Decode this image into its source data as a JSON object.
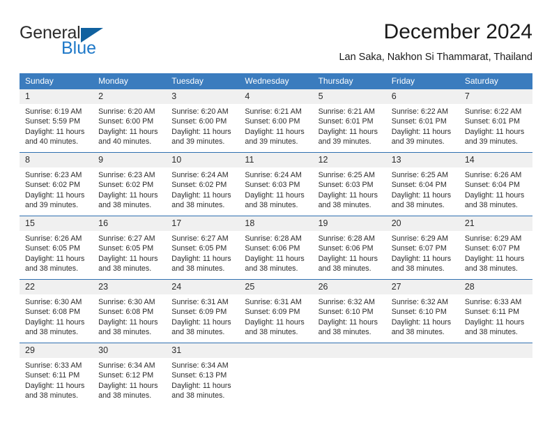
{
  "brand": {
    "name_part1": "General",
    "name_part2": "Blue",
    "logo_icon": "triangle-icon",
    "accent_color": "#1e78c8",
    "triangle_color": "#10619f"
  },
  "header": {
    "title": "December 2024",
    "subtitle": "Lan Saka, Nakhon Si Thammarat, Thailand"
  },
  "theme": {
    "header_row_bg": "#3b7cbe",
    "header_row_text": "#ffffff",
    "daynum_bg": "#f0f0f0",
    "row_divider": "#2f6fb0",
    "body_text": "#2b2b2b"
  },
  "calendar": {
    "weekday_headers": [
      "Sunday",
      "Monday",
      "Tuesday",
      "Wednesday",
      "Thursday",
      "Friday",
      "Saturday"
    ],
    "weeks": [
      [
        {
          "day": "1",
          "sunrise": "Sunrise: 6:19 AM",
          "sunset": "Sunset: 5:59 PM",
          "daylight_line1": "Daylight: 11 hours",
          "daylight_line2": "and 40 minutes."
        },
        {
          "day": "2",
          "sunrise": "Sunrise: 6:20 AM",
          "sunset": "Sunset: 6:00 PM",
          "daylight_line1": "Daylight: 11 hours",
          "daylight_line2": "and 40 minutes."
        },
        {
          "day": "3",
          "sunrise": "Sunrise: 6:20 AM",
          "sunset": "Sunset: 6:00 PM",
          "daylight_line1": "Daylight: 11 hours",
          "daylight_line2": "and 39 minutes."
        },
        {
          "day": "4",
          "sunrise": "Sunrise: 6:21 AM",
          "sunset": "Sunset: 6:00 PM",
          "daylight_line1": "Daylight: 11 hours",
          "daylight_line2": "and 39 minutes."
        },
        {
          "day": "5",
          "sunrise": "Sunrise: 6:21 AM",
          "sunset": "Sunset: 6:01 PM",
          "daylight_line1": "Daylight: 11 hours",
          "daylight_line2": "and 39 minutes."
        },
        {
          "day": "6",
          "sunrise": "Sunrise: 6:22 AM",
          "sunset": "Sunset: 6:01 PM",
          "daylight_line1": "Daylight: 11 hours",
          "daylight_line2": "and 39 minutes."
        },
        {
          "day": "7",
          "sunrise": "Sunrise: 6:22 AM",
          "sunset": "Sunset: 6:01 PM",
          "daylight_line1": "Daylight: 11 hours",
          "daylight_line2": "and 39 minutes."
        }
      ],
      [
        {
          "day": "8",
          "sunrise": "Sunrise: 6:23 AM",
          "sunset": "Sunset: 6:02 PM",
          "daylight_line1": "Daylight: 11 hours",
          "daylight_line2": "and 39 minutes."
        },
        {
          "day": "9",
          "sunrise": "Sunrise: 6:23 AM",
          "sunset": "Sunset: 6:02 PM",
          "daylight_line1": "Daylight: 11 hours",
          "daylight_line2": "and 38 minutes."
        },
        {
          "day": "10",
          "sunrise": "Sunrise: 6:24 AM",
          "sunset": "Sunset: 6:02 PM",
          "daylight_line1": "Daylight: 11 hours",
          "daylight_line2": "and 38 minutes."
        },
        {
          "day": "11",
          "sunrise": "Sunrise: 6:24 AM",
          "sunset": "Sunset: 6:03 PM",
          "daylight_line1": "Daylight: 11 hours",
          "daylight_line2": "and 38 minutes."
        },
        {
          "day": "12",
          "sunrise": "Sunrise: 6:25 AM",
          "sunset": "Sunset: 6:03 PM",
          "daylight_line1": "Daylight: 11 hours",
          "daylight_line2": "and 38 minutes."
        },
        {
          "day": "13",
          "sunrise": "Sunrise: 6:25 AM",
          "sunset": "Sunset: 6:04 PM",
          "daylight_line1": "Daylight: 11 hours",
          "daylight_line2": "and 38 minutes."
        },
        {
          "day": "14",
          "sunrise": "Sunrise: 6:26 AM",
          "sunset": "Sunset: 6:04 PM",
          "daylight_line1": "Daylight: 11 hours",
          "daylight_line2": "and 38 minutes."
        }
      ],
      [
        {
          "day": "15",
          "sunrise": "Sunrise: 6:26 AM",
          "sunset": "Sunset: 6:05 PM",
          "daylight_line1": "Daylight: 11 hours",
          "daylight_line2": "and 38 minutes."
        },
        {
          "day": "16",
          "sunrise": "Sunrise: 6:27 AM",
          "sunset": "Sunset: 6:05 PM",
          "daylight_line1": "Daylight: 11 hours",
          "daylight_line2": "and 38 minutes."
        },
        {
          "day": "17",
          "sunrise": "Sunrise: 6:27 AM",
          "sunset": "Sunset: 6:05 PM",
          "daylight_line1": "Daylight: 11 hours",
          "daylight_line2": "and 38 minutes."
        },
        {
          "day": "18",
          "sunrise": "Sunrise: 6:28 AM",
          "sunset": "Sunset: 6:06 PM",
          "daylight_line1": "Daylight: 11 hours",
          "daylight_line2": "and 38 minutes."
        },
        {
          "day": "19",
          "sunrise": "Sunrise: 6:28 AM",
          "sunset": "Sunset: 6:06 PM",
          "daylight_line1": "Daylight: 11 hours",
          "daylight_line2": "and 38 minutes."
        },
        {
          "day": "20",
          "sunrise": "Sunrise: 6:29 AM",
          "sunset": "Sunset: 6:07 PM",
          "daylight_line1": "Daylight: 11 hours",
          "daylight_line2": "and 38 minutes."
        },
        {
          "day": "21",
          "sunrise": "Sunrise: 6:29 AM",
          "sunset": "Sunset: 6:07 PM",
          "daylight_line1": "Daylight: 11 hours",
          "daylight_line2": "and 38 minutes."
        }
      ],
      [
        {
          "day": "22",
          "sunrise": "Sunrise: 6:30 AM",
          "sunset": "Sunset: 6:08 PM",
          "daylight_line1": "Daylight: 11 hours",
          "daylight_line2": "and 38 minutes."
        },
        {
          "day": "23",
          "sunrise": "Sunrise: 6:30 AM",
          "sunset": "Sunset: 6:08 PM",
          "daylight_line1": "Daylight: 11 hours",
          "daylight_line2": "and 38 minutes."
        },
        {
          "day": "24",
          "sunrise": "Sunrise: 6:31 AM",
          "sunset": "Sunset: 6:09 PM",
          "daylight_line1": "Daylight: 11 hours",
          "daylight_line2": "and 38 minutes."
        },
        {
          "day": "25",
          "sunrise": "Sunrise: 6:31 AM",
          "sunset": "Sunset: 6:09 PM",
          "daylight_line1": "Daylight: 11 hours",
          "daylight_line2": "and 38 minutes."
        },
        {
          "day": "26",
          "sunrise": "Sunrise: 6:32 AM",
          "sunset": "Sunset: 6:10 PM",
          "daylight_line1": "Daylight: 11 hours",
          "daylight_line2": "and 38 minutes."
        },
        {
          "day": "27",
          "sunrise": "Sunrise: 6:32 AM",
          "sunset": "Sunset: 6:10 PM",
          "daylight_line1": "Daylight: 11 hours",
          "daylight_line2": "and 38 minutes."
        },
        {
          "day": "28",
          "sunrise": "Sunrise: 6:33 AM",
          "sunset": "Sunset: 6:11 PM",
          "daylight_line1": "Daylight: 11 hours",
          "daylight_line2": "and 38 minutes."
        }
      ],
      [
        {
          "day": "29",
          "sunrise": "Sunrise: 6:33 AM",
          "sunset": "Sunset: 6:11 PM",
          "daylight_line1": "Daylight: 11 hours",
          "daylight_line2": "and 38 minutes."
        },
        {
          "day": "30",
          "sunrise": "Sunrise: 6:34 AM",
          "sunset": "Sunset: 6:12 PM",
          "daylight_line1": "Daylight: 11 hours",
          "daylight_line2": "and 38 minutes."
        },
        {
          "day": "31",
          "sunrise": "Sunrise: 6:34 AM",
          "sunset": "Sunset: 6:13 PM",
          "daylight_line1": "Daylight: 11 hours",
          "daylight_line2": "and 38 minutes."
        },
        {
          "day": "",
          "sunrise": "",
          "sunset": "",
          "daylight_line1": "",
          "daylight_line2": ""
        },
        {
          "day": "",
          "sunrise": "",
          "sunset": "",
          "daylight_line1": "",
          "daylight_line2": ""
        },
        {
          "day": "",
          "sunrise": "",
          "sunset": "",
          "daylight_line1": "",
          "daylight_line2": ""
        },
        {
          "day": "",
          "sunrise": "",
          "sunset": "",
          "daylight_line1": "",
          "daylight_line2": ""
        }
      ]
    ]
  }
}
